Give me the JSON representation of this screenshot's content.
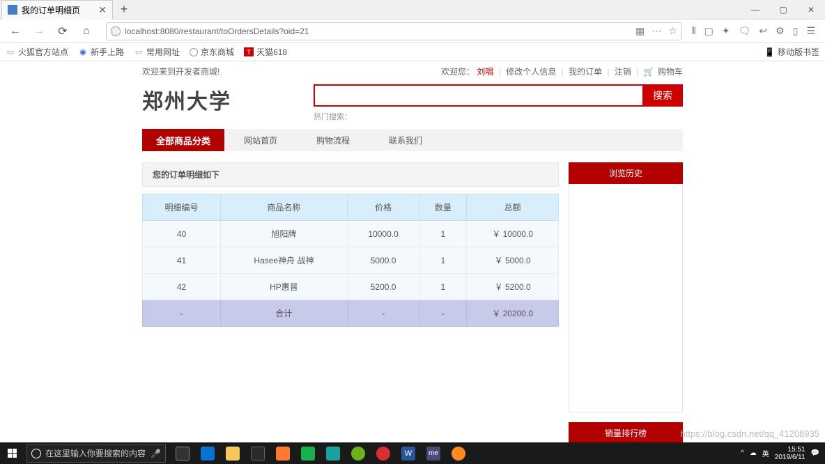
{
  "window": {
    "min": "—",
    "max": "▢",
    "close": "✕"
  },
  "tab": {
    "title": "我的订单明细页",
    "close": "✕",
    "plus": "+"
  },
  "url": {
    "value": "localhost:8080/restaurant/toOrdersDetails?oid=21",
    "info_icon": "ⓘ"
  },
  "toolbar": {
    "more": "⋯",
    "star": "☆",
    "library": "⫴",
    "gift": "▢",
    "chat": "✦",
    "speech": "🗨",
    "reply": "↩",
    "set": "⚙",
    "pocket": "▯",
    "menu": "☰",
    "qr": "▦"
  },
  "nav": {
    "back": "←",
    "forward": "→",
    "reload": "⟳",
    "home": "⌂"
  },
  "bookmarks": {
    "items": [
      {
        "icon_type": "folder",
        "label": "火狐官方站点"
      },
      {
        "icon_type": "blue",
        "label": "新手上路"
      },
      {
        "icon_type": "folder",
        "label": "常用网址"
      },
      {
        "icon_type": "globe",
        "label": "京东商城"
      },
      {
        "icon_type": "red",
        "label": "天猫618"
      }
    ],
    "mobile_icon": "📱",
    "mobile": "移动版书签"
  },
  "welcome": {
    "text": "欢迎来到开发者商城!",
    "greet": "欢迎您：",
    "user": "刘唱",
    "links": {
      "modify": "修改个人信息",
      "orders": "我的订单",
      "logout": "注销",
      "cart": "购物车"
    },
    "cart_icon": "🛒"
  },
  "logo": "郑州大学",
  "search": {
    "placeholder": "",
    "button": "搜索",
    "hot_label": "热门搜索："
  },
  "navbar": {
    "cat": "全部商品分类",
    "items": [
      "网站首页",
      "购物流程",
      "联系我们"
    ]
  },
  "panel": {
    "title": "您的订单明细如下"
  },
  "table": {
    "headers": [
      "明细编号",
      "商品名称",
      "价格",
      "数量",
      "总额"
    ],
    "rows": [
      {
        "id": "40",
        "name": "旭阳牌",
        "price": "10000.0",
        "qty": "1",
        "total": "￥ 10000.0"
      },
      {
        "id": "41",
        "name": "Hasee神舟 战神",
        "price": "5000.0",
        "qty": "1",
        "total": "￥ 5000.0"
      },
      {
        "id": "42",
        "name": "HP惠普",
        "price": "5200.0",
        "qty": "1",
        "total": "￥ 5200.0"
      }
    ],
    "totalRow": {
      "id": "-",
      "name": "合计",
      "price": "-",
      "qty": "-",
      "total": "￥ 20200.0"
    }
  },
  "side": {
    "history": "浏览历史",
    "rank": "销量排行榜"
  },
  "taskbar": {
    "search_placeholder": "在这里输入你要搜索的内容",
    "mic": "🎤",
    "clock_time": "15:51",
    "clock_date": "2019/6/11",
    "tray": [
      "^",
      "☁",
      "🔊",
      "英"
    ]
  },
  "watermark": "https://blog.csdn.net/qq_41208935"
}
